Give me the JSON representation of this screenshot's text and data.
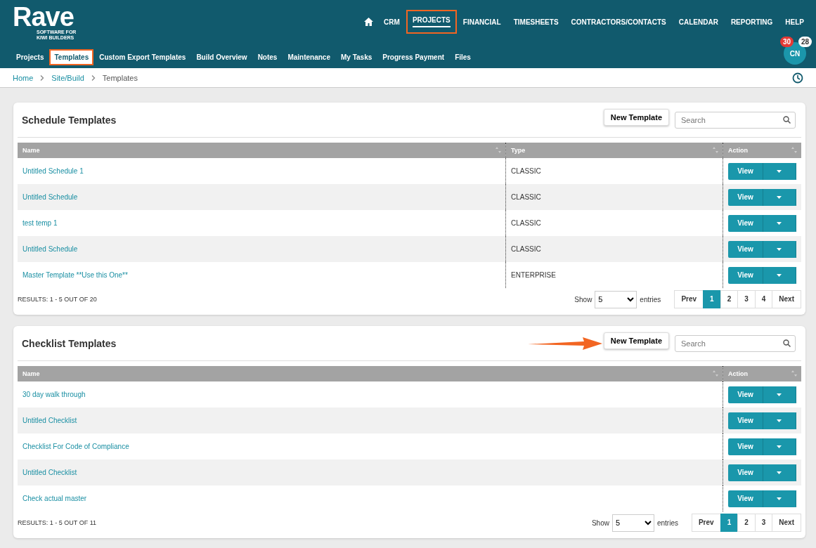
{
  "header": {
    "logo": "Rave",
    "tagline": "SOFTWARE FOR KIWI BUILDERS",
    "top_nav": [
      {
        "label": "CRM",
        "selected": false,
        "highlighted": false
      },
      {
        "label": "PROJECTS",
        "selected": true,
        "highlighted": true
      },
      {
        "label": "FINANCIAL",
        "selected": false,
        "highlighted": false
      },
      {
        "label": "TIMESHEETS",
        "selected": false,
        "highlighted": false
      },
      {
        "label": "CONTRACTORS/CONTACTS",
        "selected": false,
        "highlighted": false
      },
      {
        "label": "CALENDAR",
        "selected": false,
        "highlighted": false
      },
      {
        "label": "REPORTING",
        "selected": false,
        "highlighted": false
      },
      {
        "label": "HELP",
        "selected": false,
        "highlighted": false
      }
    ],
    "sub_nav": [
      {
        "label": "Projects",
        "selected": false,
        "highlighted": false
      },
      {
        "label": "Templates",
        "selected": true,
        "highlighted": true
      },
      {
        "label": "Custom Export Templates",
        "selected": false,
        "highlighted": false
      },
      {
        "label": "Build Overview",
        "selected": false,
        "highlighted": false
      },
      {
        "label": "Notes",
        "selected": false,
        "highlighted": false
      },
      {
        "label": "Maintenance",
        "selected": false,
        "highlighted": false
      },
      {
        "label": "My Tasks",
        "selected": false,
        "highlighted": false
      },
      {
        "label": "Progress Payment",
        "selected": false,
        "highlighted": false
      },
      {
        "label": "Files",
        "selected": false,
        "highlighted": false
      }
    ],
    "avatar": {
      "initials": "CN",
      "badges": [
        {
          "count": "30",
          "color": "#e53935"
        },
        {
          "count": "28",
          "color": "#ffffff"
        }
      ]
    }
  },
  "breadcrumb": [
    "Home",
    "Site/Build",
    "Templates"
  ],
  "sections": [
    {
      "title": "Schedule Templates",
      "new_button": "New Template",
      "annotation_arrow": false,
      "search": {
        "placeholder": "Search"
      },
      "columns": [
        "Name",
        "Type",
        "Action"
      ],
      "rows": [
        {
          "cells": [
            "Untitled Schedule 1",
            "CLASSIC"
          ],
          "action": "View"
        },
        {
          "cells": [
            "Untitled Schedule",
            "CLASSIC"
          ],
          "action": "View"
        },
        {
          "cells": [
            "test temp 1",
            "CLASSIC"
          ],
          "action": "View"
        },
        {
          "cells": [
            "Untitled Schedule",
            "CLASSIC"
          ],
          "action": "View"
        },
        {
          "cells": [
            "Master Template **Use this One**",
            "ENTERPRISE"
          ],
          "action": "View"
        }
      ],
      "results": "RESULTS: 1 - 5 OUT OF 20",
      "show": "Show",
      "page_size": "5",
      "entries": "entries",
      "pages": [
        {
          "label": "Prev",
          "selected": false
        },
        {
          "label": "1",
          "selected": true
        },
        {
          "label": "2",
          "selected": false
        },
        {
          "label": "3",
          "selected": false
        },
        {
          "label": "4",
          "selected": false
        },
        {
          "label": "Next",
          "selected": false
        }
      ]
    },
    {
      "title": "Checklist Templates",
      "new_button": "New Template",
      "annotation_arrow": true,
      "search": {
        "placeholder": "Search"
      },
      "columns": [
        "Name",
        "Action"
      ],
      "rows": [
        {
          "cells": [
            "30 day walk through"
          ],
          "action": "View"
        },
        {
          "cells": [
            "Untitled Checklist"
          ],
          "action": "View"
        },
        {
          "cells": [
            "Checklist For Code of Compliance"
          ],
          "action": "View"
        },
        {
          "cells": [
            "Untitled Checklist"
          ],
          "action": "View"
        },
        {
          "cells": [
            "Check actual master"
          ],
          "action": "View"
        }
      ],
      "results": "RESULTS: 1 - 5 OUT OF 11",
      "show": "Show",
      "page_size": "5",
      "entries": "entries",
      "pages": [
        {
          "label": "Prev",
          "selected": false
        },
        {
          "label": "1",
          "selected": true
        },
        {
          "label": "2",
          "selected": false
        },
        {
          "label": "3",
          "selected": false
        },
        {
          "label": "Next",
          "selected": false
        }
      ]
    }
  ]
}
